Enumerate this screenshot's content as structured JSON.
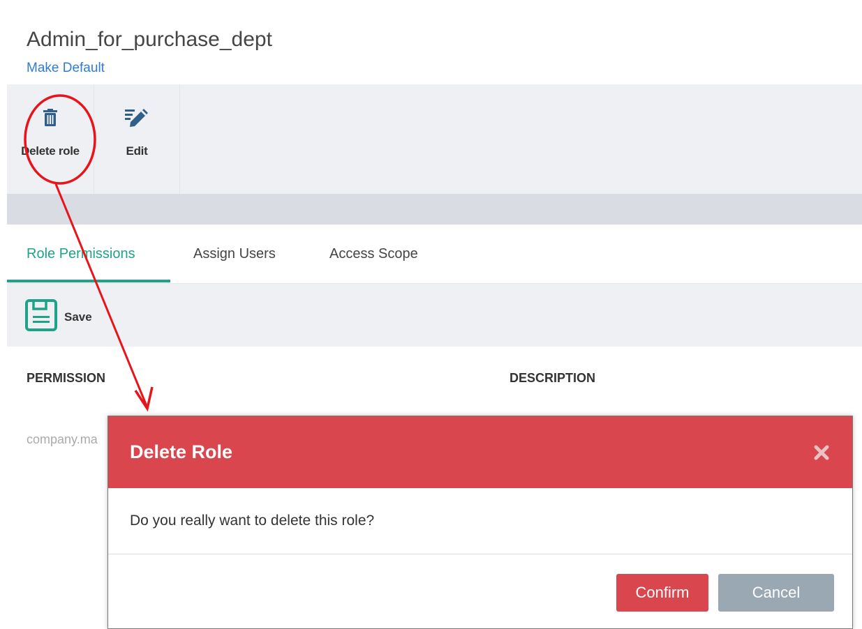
{
  "page": {
    "title": "Admin_for_purchase_dept",
    "make_default_link": "Make Default"
  },
  "toolbar": {
    "delete_label": "Delete role",
    "edit_label": "Edit"
  },
  "tabs": [
    {
      "label": "Role Permissions",
      "active": true
    },
    {
      "label": "Assign Users",
      "active": false
    },
    {
      "label": "Access Scope",
      "active": false
    }
  ],
  "action_bar": {
    "save_label": "Save"
  },
  "table": {
    "columns": [
      "PERMISSION",
      "DESCRIPTION"
    ],
    "first_row_partial": "company.ma"
  },
  "dialog": {
    "title": "Delete Role",
    "message": "Do you really want to delete this role?",
    "confirm_label": "Confirm",
    "cancel_label": "Cancel"
  },
  "colors": {
    "accent_tab": "#1ea389",
    "dialog_header": "#d9464e",
    "confirm_button": "#d9464e",
    "cancel_button": "#9aa8b4",
    "link": "#2f7bd6",
    "annotation": "#e8141b"
  },
  "icons": {
    "delete": "trash-icon",
    "edit": "edit-pencil-icon",
    "save": "floppy-disk-icon",
    "close": "close-icon"
  }
}
